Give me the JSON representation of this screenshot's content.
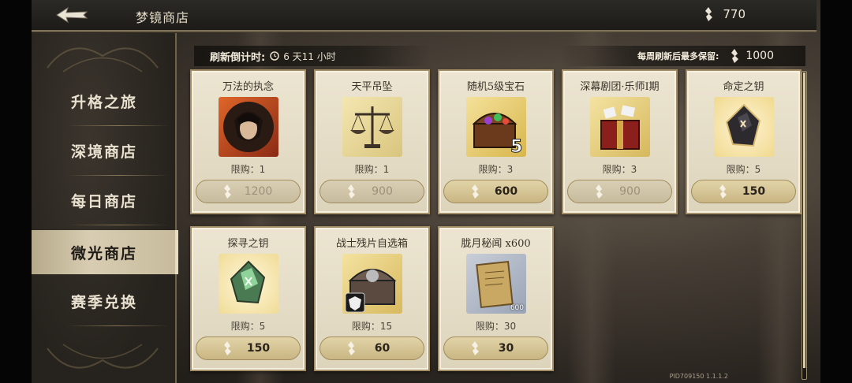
{
  "header": {
    "title": "梦镜商店",
    "currency_value": "770"
  },
  "sidebar": {
    "items": [
      {
        "label": "升格之旅",
        "active": false
      },
      {
        "label": "深境商店",
        "active": false
      },
      {
        "label": "每日商店",
        "active": false
      },
      {
        "label": "微光商店",
        "active": true
      },
      {
        "label": "赛季兑换",
        "active": false
      }
    ]
  },
  "info": {
    "refresh_label": "刷新倒计时:",
    "refresh_value": "6 天11 小时",
    "weekly_label": "每周刷新后最多保留:",
    "weekly_value": "1000"
  },
  "items": [
    {
      "name": "万法的执念",
      "limit": "限购：1",
      "price": "1200",
      "disabled": true
    },
    {
      "name": "天平吊坠",
      "limit": "限购：1",
      "price": "900",
      "disabled": true
    },
    {
      "name": "随机5级宝石",
      "limit": "限购：3",
      "price": "600",
      "disabled": false
    },
    {
      "name": "深幕剧团·乐师I期",
      "limit": "限购：3",
      "price": "900",
      "disabled": true
    },
    {
      "name": "命定之钥",
      "limit": "限购：5",
      "price": "150",
      "disabled": false
    },
    {
      "name": "探寻之钥",
      "limit": "限购：5",
      "price": "150",
      "disabled": false
    },
    {
      "name": "战士残片自选箱",
      "limit": "限购：15",
      "price": "60",
      "disabled": false
    },
    {
      "name": "胧月秘闻 x600",
      "limit": "限购：30",
      "price": "30",
      "disabled": false,
      "badge": "600"
    }
  ],
  "footer": {
    "version": "PID709150  1.1.1.2"
  },
  "colors": {
    "accent": "#c9b583",
    "card_bg": "#ece5d1",
    "active_tab": "#d8cdb2"
  }
}
